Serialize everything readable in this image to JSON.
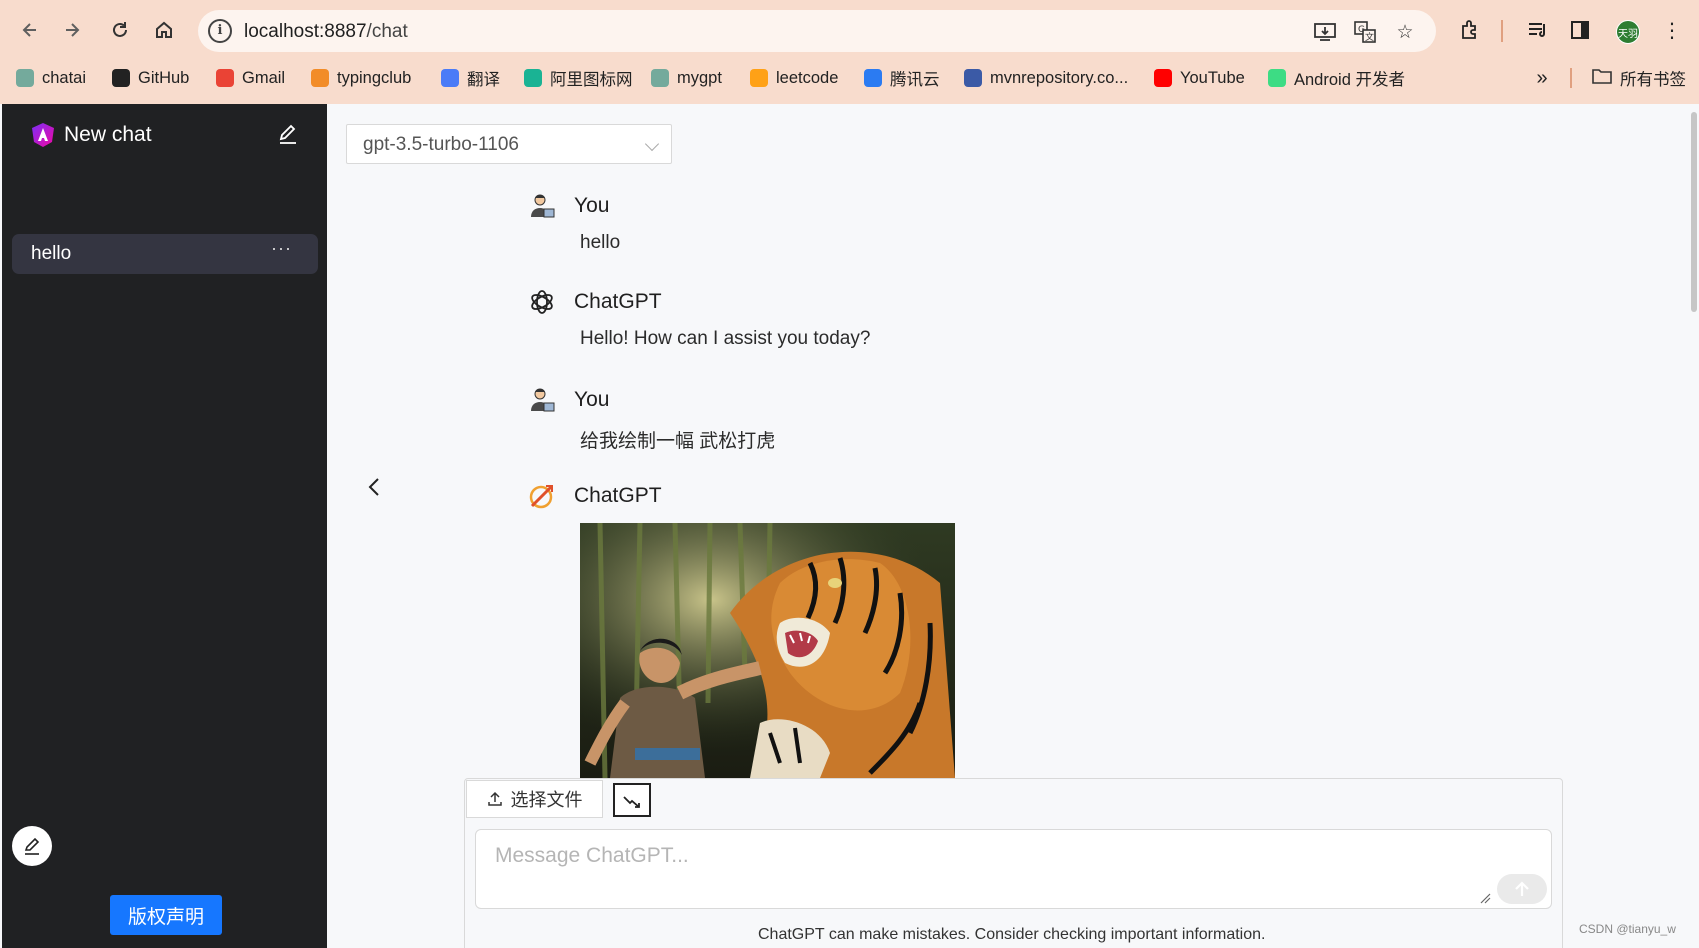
{
  "browser": {
    "url_host": "localhost:8887",
    "url_path": "/chat",
    "profile_initials": "天羽",
    "bookmarks": [
      {
        "label": "chatai",
        "icon": "openai-icon",
        "color": "#74aa9c"
      },
      {
        "label": "GitHub",
        "icon": "github-icon",
        "color": "#222222"
      },
      {
        "label": "Gmail",
        "icon": "gmail-icon",
        "color": "#ea4335"
      },
      {
        "label": "typingclub",
        "icon": "typingclub-icon",
        "color": "#f28c28"
      },
      {
        "label": "翻译",
        "icon": "translate-icon",
        "color": "#4a7bf7"
      },
      {
        "label": "阿里图标网",
        "icon": "iconfont-icon",
        "color": "#1ab394"
      },
      {
        "label": "mygpt",
        "icon": "openai-icon",
        "color": "#74aa9c"
      },
      {
        "label": "leetcode",
        "icon": "leetcode-icon",
        "color": "#ffa116"
      },
      {
        "label": "腾讯云",
        "icon": "cloud-icon",
        "color": "#2b7bf2"
      },
      {
        "label": "mvnrepository.co...",
        "icon": "mvn-icon",
        "color": "#3b5aa6"
      },
      {
        "label": "YouTube",
        "icon": "youtube-icon",
        "color": "#ff0000"
      },
      {
        "label": "Android 开发者",
        "icon": "android-icon",
        "color": "#3ddc84"
      }
    ],
    "all_bookmarks_label": "所有书签"
  },
  "sidebar": {
    "title": "New chat",
    "conversations": [
      {
        "label": "hello",
        "more": "···"
      }
    ],
    "copyright_button": "版权声明"
  },
  "main": {
    "model_select": {
      "value": "gpt-3.5-turbo-1106"
    },
    "messages": [
      {
        "author": "You",
        "text": "hello",
        "avatar": "user-avatar-icon"
      },
      {
        "author": "ChatGPT",
        "text": "Hello! How can I assist you today?",
        "avatar": "openai-icon"
      },
      {
        "author": "You",
        "text": "给我绘制一幅 武松打虎",
        "avatar": "user-avatar-icon"
      },
      {
        "author": "ChatGPT",
        "text": "",
        "avatar": "dalle-icon",
        "image": "generated-image-wusong-fighting-tiger"
      }
    ],
    "composer": {
      "upload_label": "选择文件",
      "placeholder": "Message ChatGPT..."
    },
    "disclaimer": "ChatGPT can make mistakes. Consider checking important information.",
    "watermark": "CSDN @tianyu_w"
  },
  "colors": {
    "chrome_bg": "#f8dccd",
    "sidebar_bg": "#202123",
    "accent": "#1677ff"
  }
}
